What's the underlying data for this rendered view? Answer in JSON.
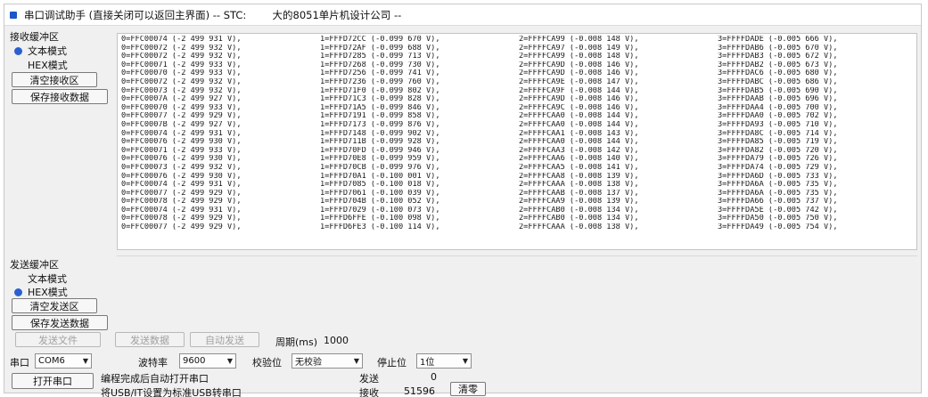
{
  "window": {
    "title": "串口调试助手 (直接关闭可以返回主界面) -- STC:        大的8051单片机设计公司 --"
  },
  "receive": {
    "group_label": "接收缓冲区",
    "text_mode_label": "文本模式",
    "hex_mode_label": "HEX模式",
    "selected_mode": "text",
    "clear_button": "清空接收区",
    "save_button": "保存接收数据",
    "rows": [
      [
        "0=FFC00074 (-2 499 931 V),",
        "1=FFFD72CC (-0.099 670 V),",
        "2=FFFFCA99 (-0.008 148 V),",
        "3=FFFFDADE (-0.005 666 V),"
      ],
      [
        "0=FFC00072 (-2 499 932 V),",
        "1=FFFD72AF (-0.099 688 V),",
        "2=FFFFCA97 (-0.008 149 V),",
        "3=FFFFDAB6 (-0.005 670 V),"
      ],
      [
        "0=FFC00072 (-2 499 932 V),",
        "1=FFFD7285 (-0.099 713 V),",
        "2=FFFFCA99 (-0.008 148 V),",
        "3=FFFFDAB3 (-0.005 672 V),"
      ],
      [
        "0=FFC00071 (-2 499 933 V),",
        "1=FFFD7268 (-0.099 730 V),",
        "2=FFFFCA9D (-0.008 146 V),",
        "3=FFFFDAB2 (-0.005 673 V),"
      ],
      [
        "0=FFC00070 (-2 499 933 V),",
        "1=FFFD7256 (-0.099 741 V),",
        "2=FFFFCA9D (-0.008 146 V),",
        "3=FFFFDAC6 (-0.005 680 V),"
      ],
      [
        "0=FFC00072 (-2 499 932 V),",
        "1=FFFD7236 (-0.099 760 V),",
        "2=FFFFCA9E (-0.008 147 V),",
        "3=FFFFDABC (-0.005 686 V),"
      ],
      [
        "0=FFC00073 (-2 499 932 V),",
        "1=FFFD71F0 (-0.099 802 V),",
        "2=FFFFCA9F (-0.008 144 V),",
        "3=FFFFDAB5 (-0.005 690 V),"
      ],
      [
        "0=FFC0007A (-2 499 927 V),",
        "1=FFFD71C3 (-0.099 828 V),",
        "2=FFFFCA9D (-0.008 146 V),",
        "3=FFFFDAAB (-0.005 696 V),"
      ],
      [
        "0=FFC00070 (-2 499 933 V),",
        "1=FFFD71A5 (-0.099 846 V),",
        "2=FFFFCA9C (-0.008 146 V),",
        "3=FFFFDAA4 (-0.005 700 V),"
      ],
      [
        "0=FFC00077 (-2 499 929 V),",
        "1=FFFD7191 (-0.099 858 V),",
        "2=FFFFCAA0 (-0.008 144 V),",
        "3=FFFFDAA0 (-0.005 702 V),"
      ],
      [
        "0=FFC0007B (-2 499 927 V),",
        "1=FFFD7173 (-0.099 876 V),",
        "2=FFFFCAA0 (-0.008 144 V),",
        "3=FFFFDA93 (-0.005 710 V),"
      ],
      [
        "0=FFC00074 (-2 499 931 V),",
        "1=FFFD7148 (-0.099 902 V),",
        "2=FFFFCAA1 (-0.008 143 V),",
        "3=FFFFDA8C (-0.005 714 V),"
      ],
      [
        "0=FFC00076 (-2 499 930 V),",
        "1=FFFD711B (-0.099 928 V),",
        "2=FFFFCAA0 (-0.008 144 V),",
        "3=FFFFDA85 (-0.005 719 V),"
      ],
      [
        "0=FFC00071 (-2 499 933 V),",
        "1=FFFD70FD (-0.099 946 V),",
        "2=FFFFCAA3 (-0.008 142 V),",
        "3=FFFFDA82 (-0.005 720 V),"
      ],
      [
        "0=FFC00076 (-2 499 930 V),",
        "1=FFFD70E8 (-0.099 959 V),",
        "2=FFFFCAA6 (-0.008 140 V),",
        "3=FFFFDA79 (-0.005 726 V),"
      ],
      [
        "0=FFC00073 (-2 499 932 V),",
        "1=FFFD70CB (-0.099 976 V),",
        "2=FFFFCAA5 (-0.008 141 V),",
        "3=FFFFDA74 (-0.005 729 V),"
      ],
      [
        "0=FFC00076 (-2 499 930 V),",
        "1=FFFD70A1 (-0.100 001 V),",
        "2=FFFFCAA8 (-0.008 139 V),",
        "3=FFFFDA6D (-0.005 733 V),"
      ],
      [
        "0=FFC00074 (-2 499 931 V),",
        "1=FFFD7085 (-0.100 018 V),",
        "2=FFFFCAAA (-0.008 138 V),",
        "3=FFFFDA6A (-0.005 735 V),"
      ],
      [
        "0=FFC00077 (-2 499 929 V),",
        "1=FFFD7061 (-0.100 039 V),",
        "2=FFFFCAAB (-0.008 137 V),",
        "3=FFFFDA6A (-0.005 735 V),"
      ],
      [
        "0=FFC00078 (-2 499 929 V),",
        "1=FFFD704B (-0.100 052 V),",
        "2=FFFFCAA9 (-0.008 139 V),",
        "3=FFFFDA66 (-0.005 737 V),"
      ],
      [
        "0=FFC00074 (-2 499 931 V),",
        "1=FFFD7029 (-0.100 073 V),",
        "2=FFFFCAB0 (-0.008 134 V),",
        "3=FFFFDA5E (-0.005 742 V),"
      ],
      [
        "0=FFC00078 (-2 499 929 V),",
        "1=FFFD6FFE (-0.100 098 V),",
        "2=FFFFCAB0 (-0.008 134 V),",
        "3=FFFFDA50 (-0.005 750 V),"
      ],
      [
        "0=FFC00077 (-2 499 929 V),",
        "1=FFFD6FE3 (-0.100 114 V),",
        "2=FFFFCAAA (-0.008 138 V),",
        "3=FFFFDA49 (-0.005 754 V),"
      ]
    ]
  },
  "send": {
    "group_label": "发送缓冲区",
    "text_mode_label": "文本模式",
    "hex_mode_label": "HEX模式",
    "selected_mode": "hex",
    "clear_button": "清空发送区",
    "save_button": "保存发送数据",
    "send_file_button": "发送文件",
    "send_data_button": "发送数据",
    "auto_send_button": "自动发送",
    "period_label": "周期(ms)",
    "period_value": "1000"
  },
  "settings": {
    "port_label": "串口",
    "port_value": "COM6",
    "baud_label": "波特率",
    "baud_value": "9600",
    "parity_label": "校验位",
    "parity_value": "无校验",
    "stop_label": "停止位",
    "stop_value": "1位",
    "open_port_button": "打开串口",
    "note_line1": "编程完成后自动打开串口",
    "note_line2": "将USB/IT设置为标准USB转串口",
    "sent_label": "发送",
    "sent_count": "0",
    "recv_label": "接收",
    "recv_count": "51596",
    "clear_counts_button": "清零"
  },
  "icons": {
    "app": "app-icon",
    "dropdown": "chevron-down-icon"
  },
  "colors": {
    "accent": "#2b5fd0",
    "window_bg": "#f0f0f0",
    "text_area_bg": "#ffffff"
  }
}
